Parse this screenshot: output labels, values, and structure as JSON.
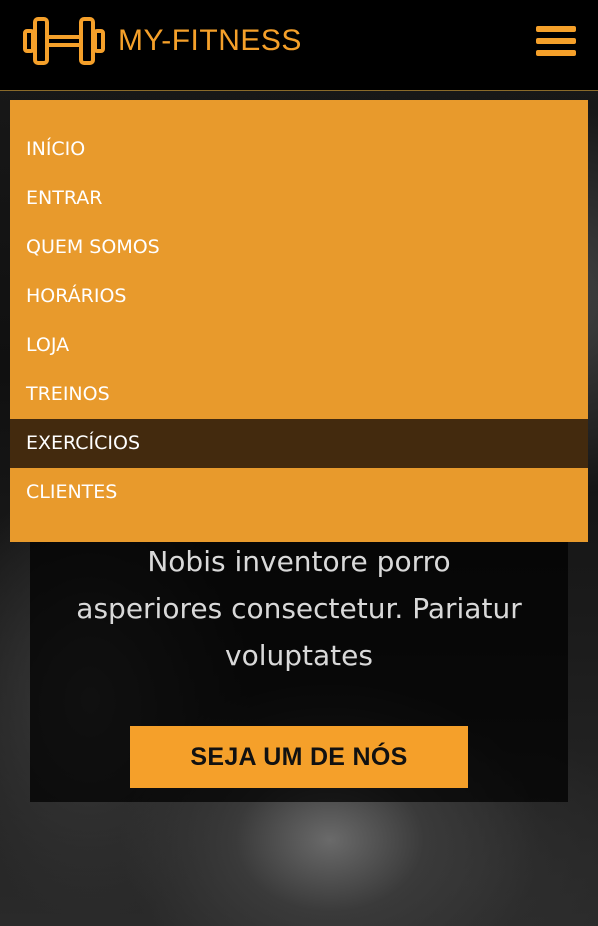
{
  "header": {
    "brand_name": "MY-FITNESS",
    "logo_icon": "dumbbell-icon",
    "menu_icon": "hamburger-menu-icon"
  },
  "nav": {
    "items": [
      {
        "label": "INÍCIO",
        "active": false
      },
      {
        "label": "ENTRAR",
        "active": false
      },
      {
        "label": "QUEM SOMOS",
        "active": false
      },
      {
        "label": "HORÁRIOS",
        "active": false
      },
      {
        "label": "LOJA",
        "active": false
      },
      {
        "label": "TREINOS",
        "active": false
      },
      {
        "label": "EXERCÍCIOS",
        "active": true
      },
      {
        "label": "CLIENTES",
        "active": false
      }
    ]
  },
  "hero": {
    "line1": "Nobis inventore porro",
    "line2": "asperiores consectetur. Pariatur",
    "line3": "voluptates",
    "cta_label": "SEJA UM DE NÓS"
  },
  "colors": {
    "accent": "#f5a02a",
    "menu_background": "#e89a2c",
    "menu_active": "#432a0e",
    "header_background": "#000000"
  }
}
